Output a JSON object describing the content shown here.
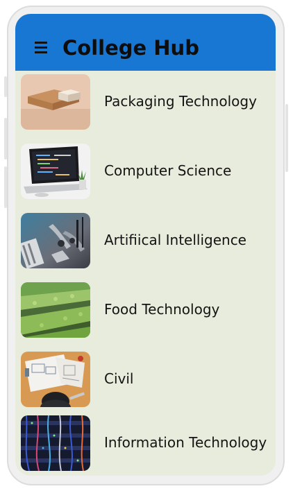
{
  "app_bar": {
    "title": "College Hub",
    "menu_icon": "hamburger-menu-icon",
    "color": "#1877d2"
  },
  "list": {
    "background": "#e8ecdc",
    "items": [
      {
        "label": "Packaging Technology",
        "image": "cardboard-boxes-photo"
      },
      {
        "label": "Computer Science",
        "image": "laptop-code-photo"
      },
      {
        "label": "Artifiical Intelligence",
        "image": "robot-hand-photo"
      },
      {
        "label": "Food Technology",
        "image": "crop-field-photo"
      },
      {
        "label": "Civil",
        "image": "blueprint-desk-photo"
      },
      {
        "label": "Information Technology",
        "image": "server-cables-photo"
      }
    ]
  }
}
